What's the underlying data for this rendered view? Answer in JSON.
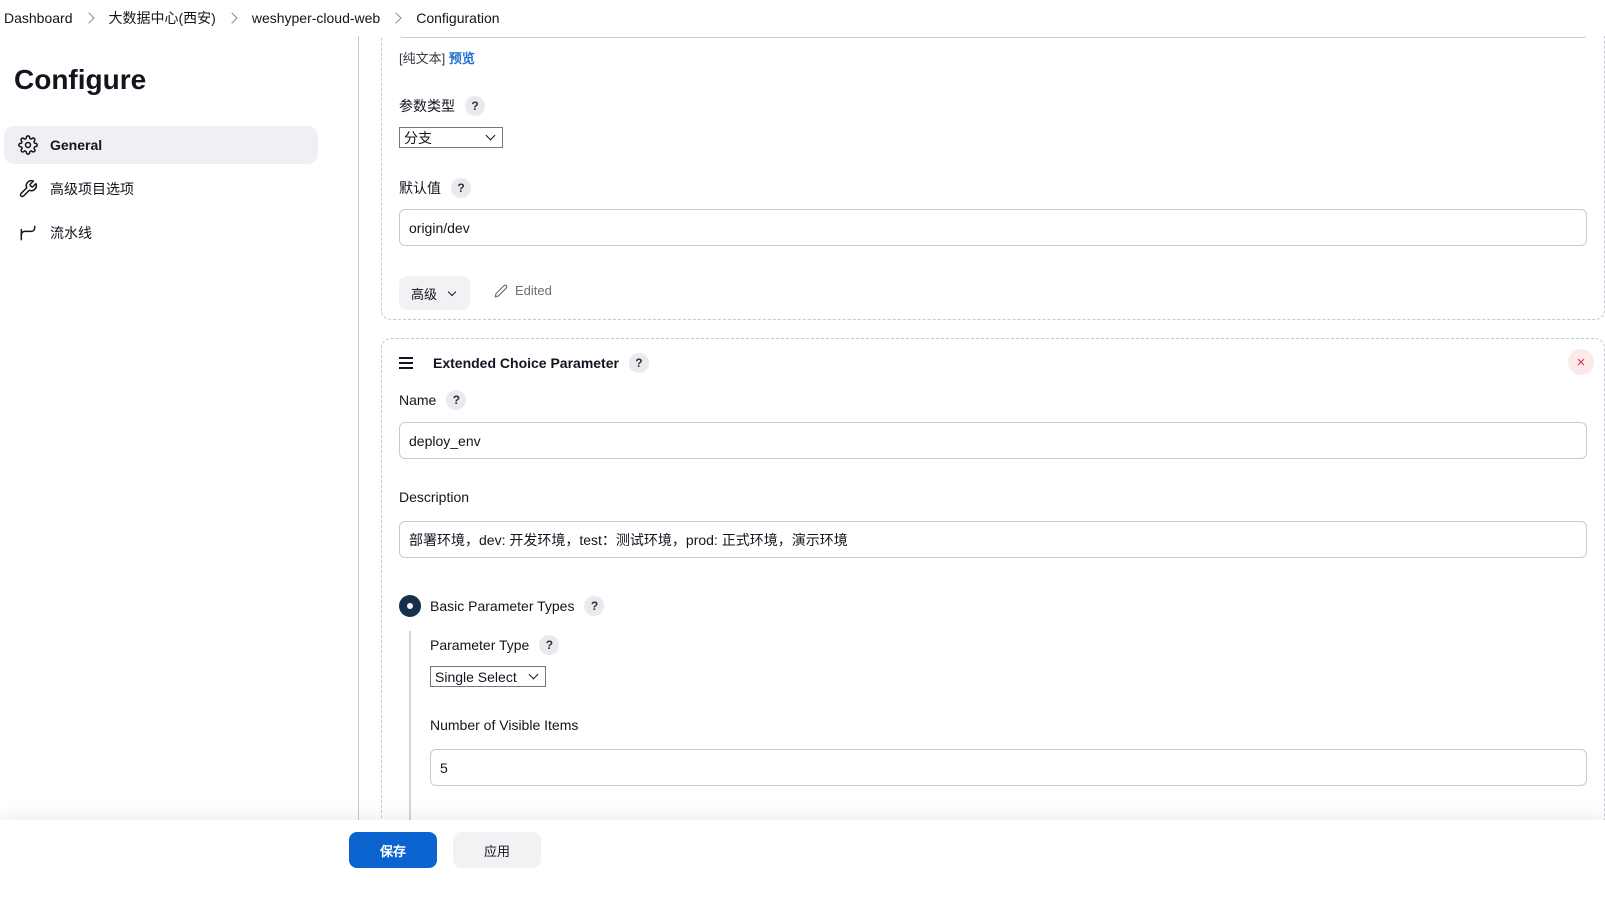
{
  "breadcrumb": {
    "items": [
      "Dashboard",
      "大数据中心(西安)",
      "weshyper-cloud-web",
      "Configuration"
    ]
  },
  "sidebar": {
    "title": "Configure",
    "items": [
      {
        "label": "General",
        "icon": "gear-icon"
      },
      {
        "label": "高级项目选项",
        "icon": "wrench-icon"
      },
      {
        "label": "流水线",
        "icon": "pipeline-icon"
      }
    ]
  },
  "section1": {
    "hint_prefix": "[纯文本]",
    "hint_link": "预览",
    "param_type_label": "参数类型",
    "param_type_value": "分支",
    "default_label": "默认值",
    "default_value": "origin/dev",
    "advanced_label": "高级",
    "edited_label": "Edited"
  },
  "section2": {
    "title": "Extended Choice Parameter",
    "name_label": "Name",
    "name_value": "deploy_env",
    "description_label": "Description",
    "description_value": "部署环境，dev: 开发环境，test：测试环境，prod: 正式环境，演示环境",
    "basic_types_label": "Basic Parameter Types",
    "parameter_type_label": "Parameter Type",
    "parameter_type_value": "Single Select",
    "visible_items_label": "Number of Visible Items",
    "visible_items_value": "5",
    "help_symbol": "?",
    "close_symbol": "×"
  },
  "footer": {
    "save_label": "保存",
    "apply_label": "应用"
  },
  "colors": {
    "primary": "#0b63cf",
    "radio": "#14304a",
    "link": "#1f6fd1",
    "close": "#d6334a"
  }
}
